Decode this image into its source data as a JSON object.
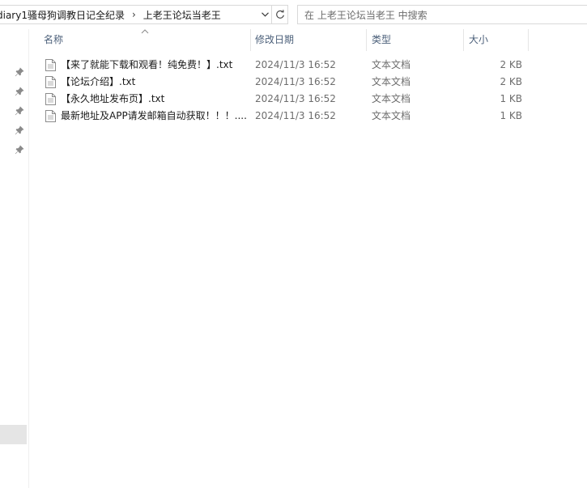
{
  "address": {
    "crumbs": [
      "diary1骚母狗调教日记全纪录",
      "上老王论坛当老王"
    ],
    "separator": "›"
  },
  "search": {
    "placeholder": "在 上老王论坛当老王 中搜索"
  },
  "columns": {
    "name": "名称",
    "date": "修改日期",
    "type": "类型",
    "size": "大小"
  },
  "files": [
    {
      "name": "【来了就能下载和观看！纯免费！】.txt",
      "date": "2024/11/3 16:52",
      "type": "文本文档",
      "size": "2 KB"
    },
    {
      "name": "【论坛介绍】.txt",
      "date": "2024/11/3 16:52",
      "type": "文本文档",
      "size": "2 KB"
    },
    {
      "name": "【永久地址发布页】.txt",
      "date": "2024/11/3 16:52",
      "type": "文本文档",
      "size": "1 KB"
    },
    {
      "name": "最新地址及APP请发邮箱自动获取！！！....",
      "date": "2024/11/3 16:52",
      "type": "文本文档",
      "size": "1 KB"
    }
  ],
  "icons": {
    "pin": "pin-icon",
    "file": "text-file-icon",
    "refresh": "refresh-icon",
    "dropdown": "chevron-down-icon",
    "sort": "chevron-up-icon"
  }
}
